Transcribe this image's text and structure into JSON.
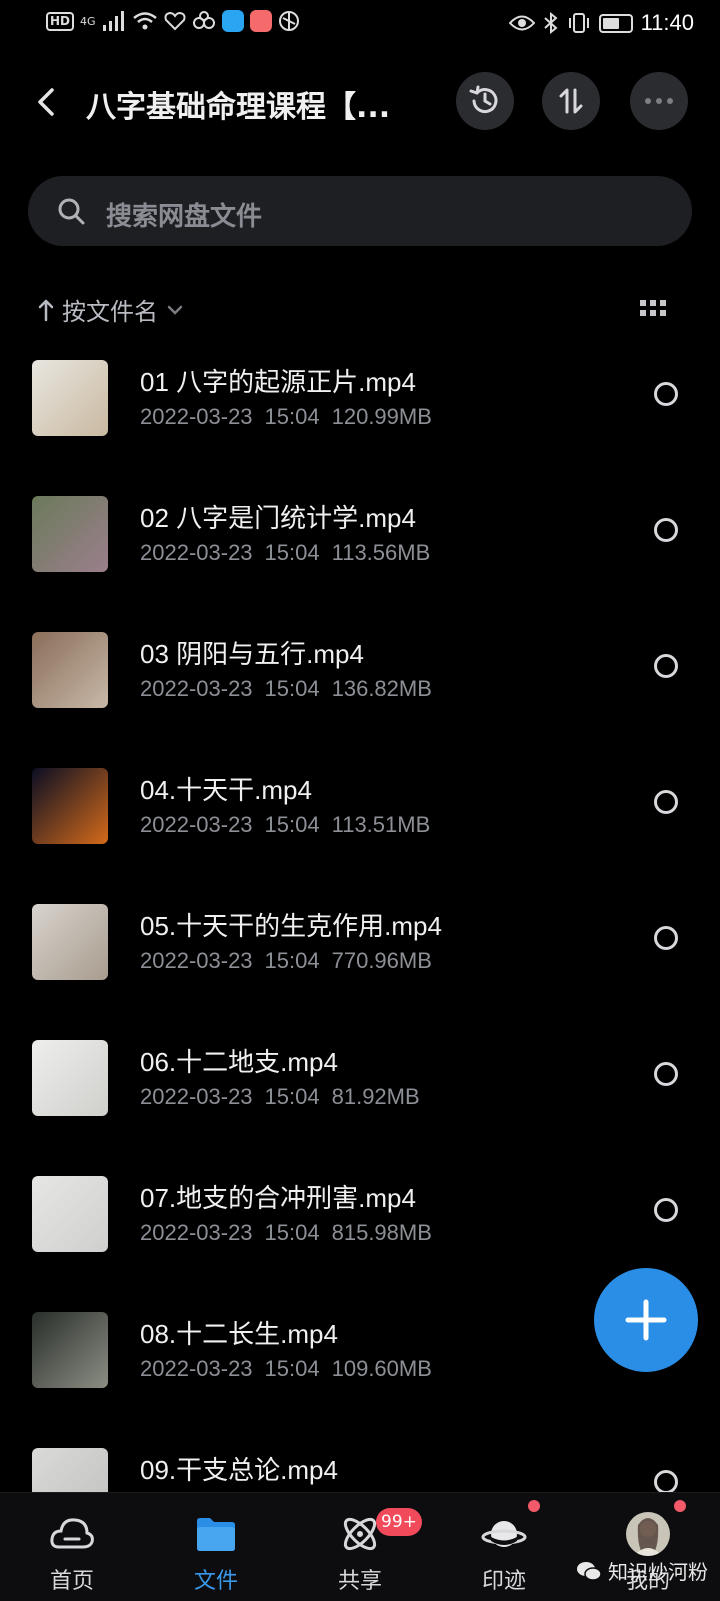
{
  "status_bar": {
    "hd": "HD",
    "signal": "4G",
    "time": "11:40",
    "battery_level": 0.7,
    "app_colors": [
      "#3d7ee8",
      "#2aa5f2",
      "#f56a6a"
    ]
  },
  "header": {
    "title": "八字基础命理课程【...",
    "history_icon": "history-icon",
    "sort_icon": "sort-toggle-icon",
    "more_icon": "more-icon"
  },
  "search": {
    "placeholder": "搜索网盘文件"
  },
  "sort": {
    "label": "按文件名"
  },
  "files": [
    {
      "name": "01 八字的起源正片.mp4",
      "date": "2022-03-23",
      "time": "15:04",
      "size": "120.99MB",
      "thumb": [
        "#e8e6e0",
        "#c9b9a0"
      ]
    },
    {
      "name": "02 八字是门统计学.mp4",
      "date": "2022-03-23",
      "time": "15:04",
      "size": "113.56MB",
      "thumb": [
        "#6b7a5a",
        "#9b7f8c"
      ]
    },
    {
      "name": "03 阴阳与五行.mp4",
      "date": "2022-03-23",
      "time": "15:04",
      "size": "136.82MB",
      "thumb": [
        "#8a6e5a",
        "#c8b8a8"
      ]
    },
    {
      "name": "04.十天干.mp4",
      "date": "2022-03-23",
      "time": "15:04",
      "size": "113.51MB",
      "thumb": [
        "#0a0e24",
        "#d46a1a"
      ]
    },
    {
      "name": "05.十天干的生克作用.mp4",
      "date": "2022-03-23",
      "time": "15:04",
      "size": "770.96MB",
      "thumb": [
        "#d8d4ce",
        "#a89c8e"
      ]
    },
    {
      "name": "06.十二地支.mp4",
      "date": "2022-03-23",
      "time": "15:04",
      "size": "81.92MB",
      "thumb": [
        "#eeeeec",
        "#cfcfcc"
      ]
    },
    {
      "name": "07.地支的合冲刑害.mp4",
      "date": "2022-03-23",
      "time": "15:04",
      "size": "815.98MB",
      "thumb": [
        "#e6e6e4",
        "#cfcfcd"
      ]
    },
    {
      "name": "08.十二长生.mp4",
      "date": "2022-03-23",
      "time": "15:04",
      "size": "109.60MB",
      "thumb": [
        "#2a2e2a",
        "#8a8e84"
      ]
    },
    {
      "name": "09.干支总论.mp4",
      "date": "",
      "time": "",
      "size": "",
      "thumb": [
        "#dadad8",
        "#c0c0be"
      ]
    }
  ],
  "nav": [
    {
      "label": "首页",
      "icon": "cloud-home-icon"
    },
    {
      "label": "文件",
      "icon": "folder-icon"
    },
    {
      "label": "共享",
      "icon": "atom-share-icon"
    },
    {
      "label": "印迹",
      "icon": "planet-icon"
    },
    {
      "label": "我的",
      "icon": "avatar"
    }
  ],
  "nav_badge": "99+",
  "watermark": "知识炒河粉",
  "colors": {
    "accent": "#2a8ee6",
    "badge": "#f04a5b"
  }
}
